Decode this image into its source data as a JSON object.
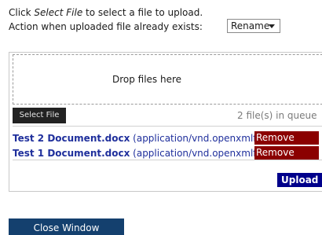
{
  "instructions": {
    "prefix": "Click ",
    "emphasis": "Select File",
    "suffix": " to select a file to upload.",
    "action_label": "Action when uploaded file already exists:"
  },
  "action_select": {
    "selected": "Rename"
  },
  "dropzone": {
    "text": "Drop files here"
  },
  "controls": {
    "select_file_label": "Select File",
    "queue_count": "2 file(s) in queue",
    "upload_label": "Upload",
    "close_label": "Close Window"
  },
  "files": [
    {
      "name": "Test 2 Document.docx",
      "type": " (application/vnd.openxmlf",
      "remove_label": "Remove"
    },
    {
      "name": "Test 1 Document.docx",
      "type": " (application/vnd.openxmlf",
      "remove_label": "Remove"
    }
  ],
  "colors": {
    "file_text": "#1f2f9c",
    "remove_bg": "#8b0000",
    "upload_bg": "#00008b",
    "close_bg": "#14406e",
    "select_file_bg": "#222222"
  }
}
